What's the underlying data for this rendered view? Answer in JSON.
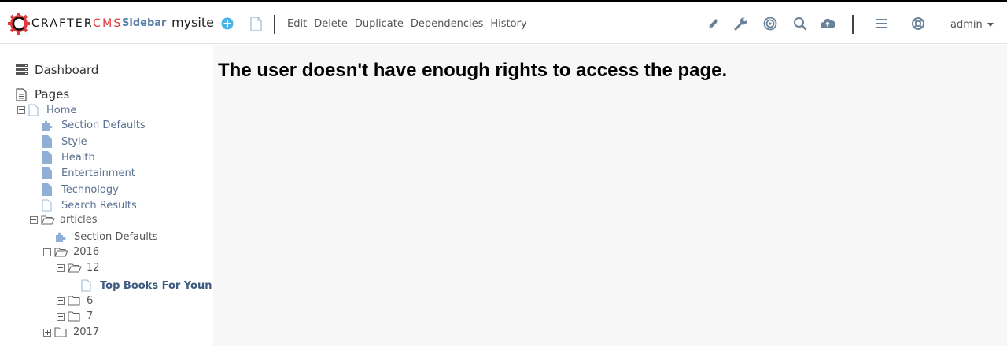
{
  "header": {
    "logo": {
      "crafter": "CRAFTER",
      "cms": "CMS"
    },
    "sidebar_label": "Sidebar",
    "site_name": "mysite",
    "menu": [
      "Edit",
      "Delete",
      "Duplicate",
      "Dependencies",
      "History"
    ],
    "user": "admin",
    "icons": [
      "plus-circle-icon",
      "new-page-icon",
      "pencil-icon",
      "wrench-icon",
      "target-icon",
      "search-icon",
      "cloud-upload-icon",
      "hamburger-icon",
      "lifebuoy-icon"
    ],
    "colors": {
      "accent_blue": "#5a7fa7",
      "plus_blue": "#4ab3e8",
      "logo_red": "#e03a3a"
    }
  },
  "sidebar": {
    "dashboard": "Dashboard",
    "pages": "Pages",
    "tree": [
      {
        "label": "Home",
        "icon": "page-outline-icon",
        "expander": "minus"
      },
      {
        "label": "Section Defaults",
        "icon": "puzzle-icon"
      },
      {
        "label": "Style",
        "icon": "page-filled-icon"
      },
      {
        "label": "Health",
        "icon": "page-filled-icon"
      },
      {
        "label": "Entertainment",
        "icon": "page-filled-icon"
      },
      {
        "label": "Technology",
        "icon": "page-filled-icon"
      },
      {
        "label": "Search Results",
        "icon": "page-outline-icon"
      },
      {
        "label": "articles",
        "icon": "folder-open-icon",
        "expander": "minus"
      },
      {
        "label": "Section Defaults",
        "icon": "puzzle-icon"
      },
      {
        "label": "2016",
        "icon": "folder-open-icon",
        "expander": "minus"
      },
      {
        "label": "12",
        "icon": "folder-open-icon",
        "expander": "minus"
      },
      {
        "label": "Top Books For Young W",
        "icon": "page-outline-icon"
      },
      {
        "label": "6",
        "icon": "folder-icon",
        "expander": "plus"
      },
      {
        "label": "7",
        "icon": "folder-icon",
        "expander": "plus"
      },
      {
        "label": "2017",
        "icon": "folder-icon",
        "expander": "plus"
      }
    ]
  },
  "main": {
    "message": "The user doesn't have enough rights to access the page."
  }
}
